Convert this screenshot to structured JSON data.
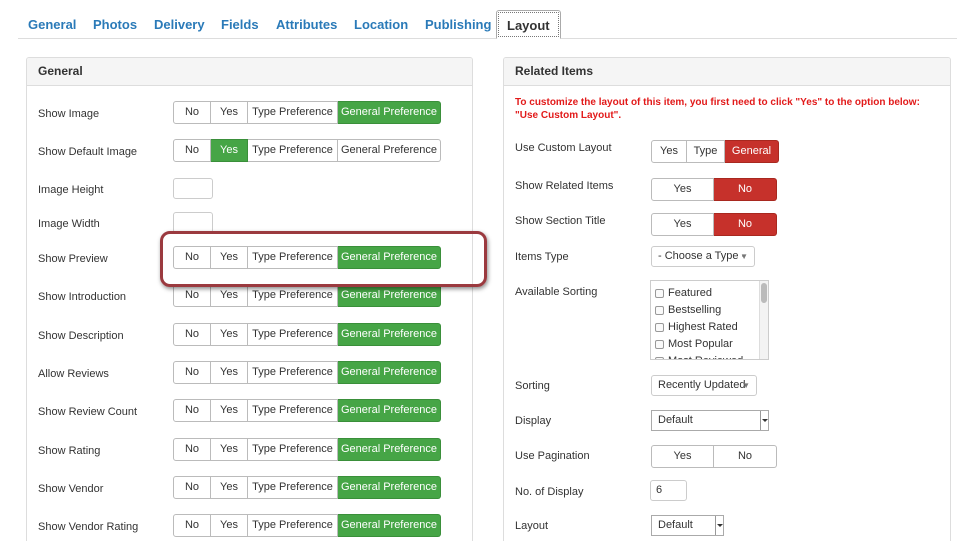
{
  "tabs": [
    "General",
    "Photos",
    "Delivery",
    "Fields",
    "Attributes",
    "Location",
    "Publishing",
    "Layout"
  ],
  "general": {
    "title": "General",
    "options": {
      "no": "No",
      "yes": "Yes",
      "tp": "Type Preference",
      "gp": "General Preference"
    },
    "rows": [
      {
        "label": "Show Image",
        "selected": "gp"
      },
      {
        "label": "Show Default Image",
        "selected": "yes"
      },
      {
        "label": "Image Height",
        "value": ""
      },
      {
        "label": "Image Width",
        "value": ""
      },
      {
        "label": "Show Preview",
        "selected": "gp"
      },
      {
        "label": "Show Introduction",
        "selected": "gp"
      },
      {
        "label": "Show Description",
        "selected": "gp"
      },
      {
        "label": "Allow Reviews",
        "selected": "gp"
      },
      {
        "label": "Show Review Count",
        "selected": "gp"
      },
      {
        "label": "Show Rating",
        "selected": "gp"
      },
      {
        "label": "Show Vendor",
        "selected": "gp"
      },
      {
        "label": "Show Vendor Rating",
        "selected": "gp"
      }
    ]
  },
  "related": {
    "title": "Related Items",
    "notice": "To customize the layout of this item, you first need to click \"Yes\" to the option below: \"Use Custom Layout\".",
    "use_custom_layout": {
      "label": "Use Custom Layout",
      "yes": "Yes",
      "type": "Type",
      "general": "General",
      "selected": "general"
    },
    "show_related_items": {
      "label": "Show Related Items",
      "yes": "Yes",
      "no": "No",
      "selected": "no"
    },
    "show_section_title": {
      "label": "Show Section Title",
      "yes": "Yes",
      "no": "No",
      "selected": "no"
    },
    "items_type": {
      "label": "Items Type",
      "value": "- Choose a Type -"
    },
    "available_sorting": {
      "label": "Available Sorting",
      "options": [
        "Featured",
        "Bestselling",
        "Highest Rated",
        "Most Popular",
        "Most Reviewed"
      ]
    },
    "sorting": {
      "label": "Sorting",
      "value": "Recently Updated"
    },
    "display": {
      "label": "Display",
      "value": "Default"
    },
    "use_pagination": {
      "label": "Use Pagination",
      "yes": "Yes",
      "no": "No"
    },
    "no_of_display": {
      "label": "No. of Display",
      "value": "6"
    },
    "layout": {
      "label": "Layout",
      "value": "Default"
    }
  },
  "colors": {
    "link": "#2a7ab8",
    "green": "#46a546",
    "red": "#c6312b",
    "notice": "#e21a1a",
    "highlight": "#9b3a3f"
  }
}
